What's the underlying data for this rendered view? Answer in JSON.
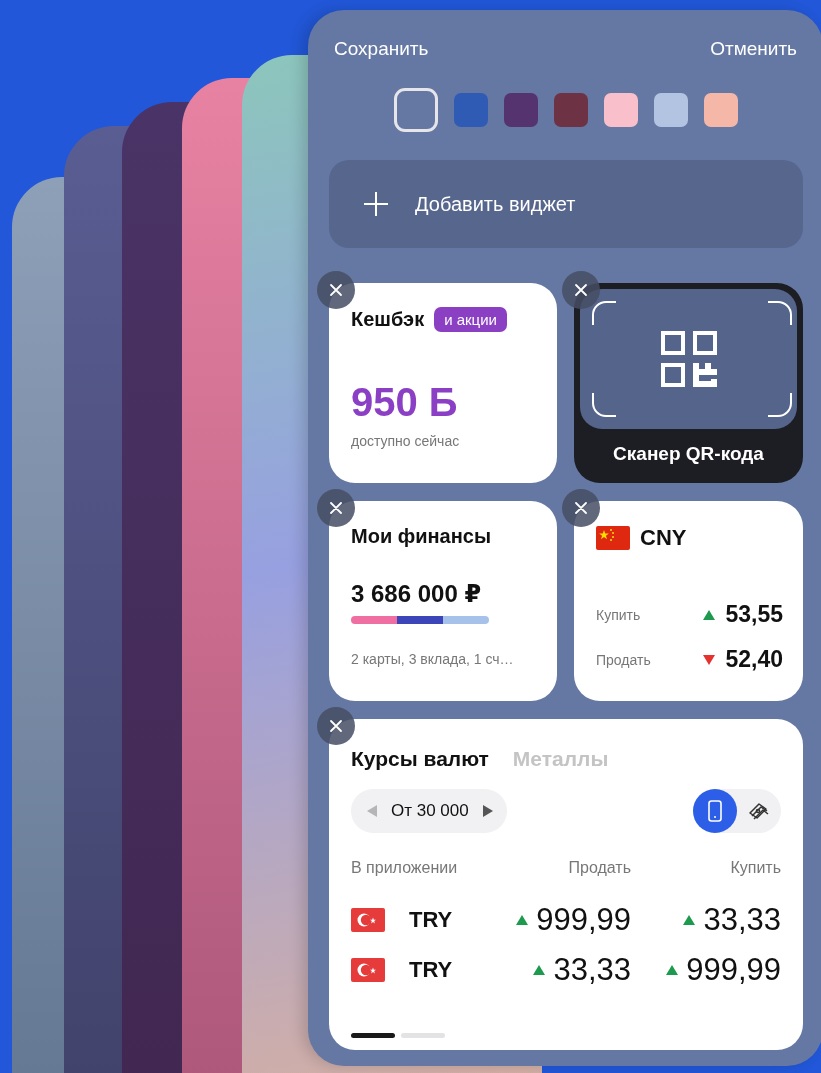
{
  "header": {
    "save": "Сохранить",
    "cancel": "Отменить"
  },
  "swatches": [
    {
      "color": "#6577a3",
      "selected": true
    },
    {
      "color": "#2f5bb5",
      "selected": false
    },
    {
      "color": "#54336e",
      "selected": false
    },
    {
      "color": "#6d3244",
      "selected": false
    },
    {
      "color": "#f9bfca",
      "selected": false
    },
    {
      "color": "#b3c3e2",
      "selected": false
    },
    {
      "color": "#f5b8a8",
      "selected": false
    }
  ],
  "add_widget": {
    "label": "Добавить виджет"
  },
  "cashback": {
    "title": "Кешбэк",
    "badge": "и акции",
    "amount": "950 Б",
    "caption": "доступно сейчас"
  },
  "qr_scanner": {
    "label": "Сканер QR-кода"
  },
  "finances": {
    "title": "Мои финансы",
    "amount": "3 686 000 ₽",
    "segments": [
      {
        "color": "#ef6fa3"
      },
      {
        "color": "#3d46b8"
      },
      {
        "color": "#a7c2ea"
      }
    ],
    "caption": "2 карты, 3 вклада, 1 сч…"
  },
  "cny": {
    "code": "CNY",
    "rows": [
      {
        "label": "Купить",
        "rising": true,
        "value": "53,55"
      },
      {
        "label": "Продать",
        "rising": false,
        "value": "52,40"
      }
    ]
  },
  "rates": {
    "tabs": [
      {
        "label": "Курсы валют",
        "selected": true
      },
      {
        "label": "Металлы",
        "selected": false
      }
    ],
    "amount_stepper": {
      "label": "От 30 000"
    },
    "modes": [
      {
        "kind": "phone",
        "selected": true
      },
      {
        "kind": "cash",
        "selected": false
      }
    ],
    "columns": [
      "В приложении",
      "Продать",
      "Купить"
    ],
    "rows": [
      {
        "code": "TRY",
        "sell": {
          "rising": true,
          "value": "999,99"
        },
        "buy": {
          "rising": true,
          "value": "33,33"
        }
      },
      {
        "code": "TRY",
        "sell": {
          "rising": true,
          "value": "33,33"
        },
        "buy": {
          "rising": true,
          "value": "999,99"
        }
      }
    ],
    "pages": [
      {
        "selected": true
      },
      {
        "selected": false
      }
    ]
  }
}
